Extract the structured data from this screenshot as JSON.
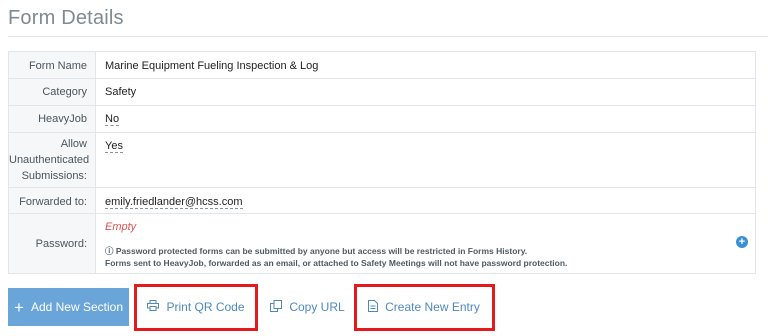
{
  "page_title": "Form Details",
  "fields": {
    "form_name": {
      "label": "Form Name",
      "value": "Marine Equipment Fueling Inspection & Log"
    },
    "category": {
      "label": "Category",
      "value": "Safety"
    },
    "heavyjob": {
      "label": "HeavyJob",
      "value": "No"
    },
    "allow_unauth": {
      "label_line1": "Allow",
      "label_line2": "Unauthenticated",
      "label_line3": "Submissions:",
      "value": "Yes"
    },
    "forwarded_to": {
      "label": "Forwarded to:",
      "value": "emily.friedlander@hcss.com"
    },
    "password": {
      "label": "Password:",
      "value": "Empty",
      "note_line1": "Password protected forms can be submitted by anyone but access will be restricted in Forms History.",
      "note_line2": "Forms sent to HeavyJob, forwarded as an email, or attached to Safety Meetings will not have password protection."
    }
  },
  "buttons": {
    "add_section": "Add New Section",
    "print_qr": "Print QR Code",
    "copy_url": "Copy URL",
    "create_entry": "Create New Entry"
  },
  "icons": {
    "info": "info-circle-icon",
    "add_password": "plus-circle-icon",
    "add_section": "plus-icon",
    "print": "printer-icon",
    "copy": "copy-icon",
    "create": "document-icon"
  },
  "colors": {
    "primary_button": "#6aa5d9",
    "link_text": "#4f88bf",
    "highlight_box": "#e41a1c",
    "empty_text": "#d9534f"
  }
}
